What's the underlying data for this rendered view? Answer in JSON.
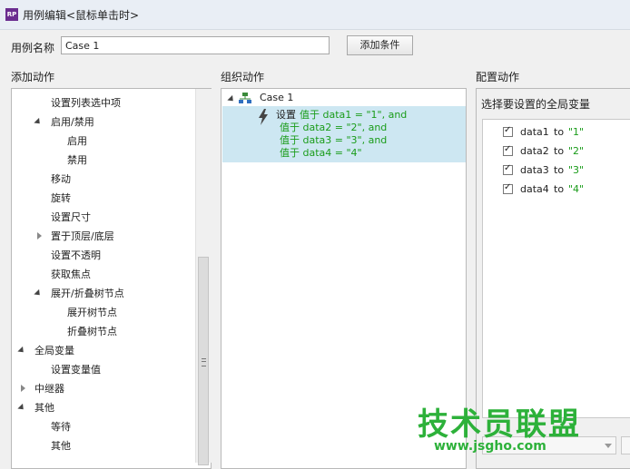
{
  "window": {
    "title": "用例编辑<鼠标单击时>",
    "app_icon_text": "RP"
  },
  "case_name": {
    "label": "用例名称",
    "value": "Case 1",
    "add_condition": "添加条件"
  },
  "sections": {
    "add_action": "添加动作",
    "organize_action": "组织动作",
    "configure_action": "配置动作"
  },
  "actions_tree": {
    "items": [
      {
        "label": "设置列表选中项"
      },
      {
        "label": "启用/禁用"
      },
      {
        "label": "启用"
      },
      {
        "label": "禁用"
      },
      {
        "label": "移动"
      },
      {
        "label": "旋转"
      },
      {
        "label": "设置尺寸"
      },
      {
        "label": "置于顶层/底层"
      },
      {
        "label": "设置不透明"
      },
      {
        "label": "获取焦点"
      },
      {
        "label": "展开/折叠树节点"
      },
      {
        "label": "展开树节点"
      },
      {
        "label": "折叠树节点"
      },
      {
        "label": "全局变量"
      },
      {
        "label": "设置变量值"
      },
      {
        "label": "中继器"
      },
      {
        "label": "其他"
      },
      {
        "label": "等待"
      },
      {
        "label": "其他"
      }
    ]
  },
  "organize": {
    "case_label": "Case 1",
    "action_verb": "设置",
    "lines": [
      "值于 data1 = \"1\", and",
      "值于 data2 = \"2\", and",
      "值于 data3 = \"3\", and",
      "值于 data4 = \"4\""
    ]
  },
  "configure": {
    "heading": "选择要设置的全局变量",
    "variables": [
      {
        "name": "data1",
        "to": "to",
        "value": "\"1\"",
        "checked": true
      },
      {
        "name": "data2",
        "to": "to",
        "value": "\"2\"",
        "checked": true
      },
      {
        "name": "data3",
        "to": "to",
        "value": "\"3\"",
        "checked": true
      },
      {
        "name": "data4",
        "to": "to",
        "value": "\"4\"",
        "checked": true
      }
    ]
  },
  "watermark": {
    "text": "技术员联盟",
    "url": "www.jsgho.com"
  },
  "colors": {
    "accent_green": "#1a9c1a",
    "selection": "#cde7f2",
    "watermark": "#2db13a"
  }
}
